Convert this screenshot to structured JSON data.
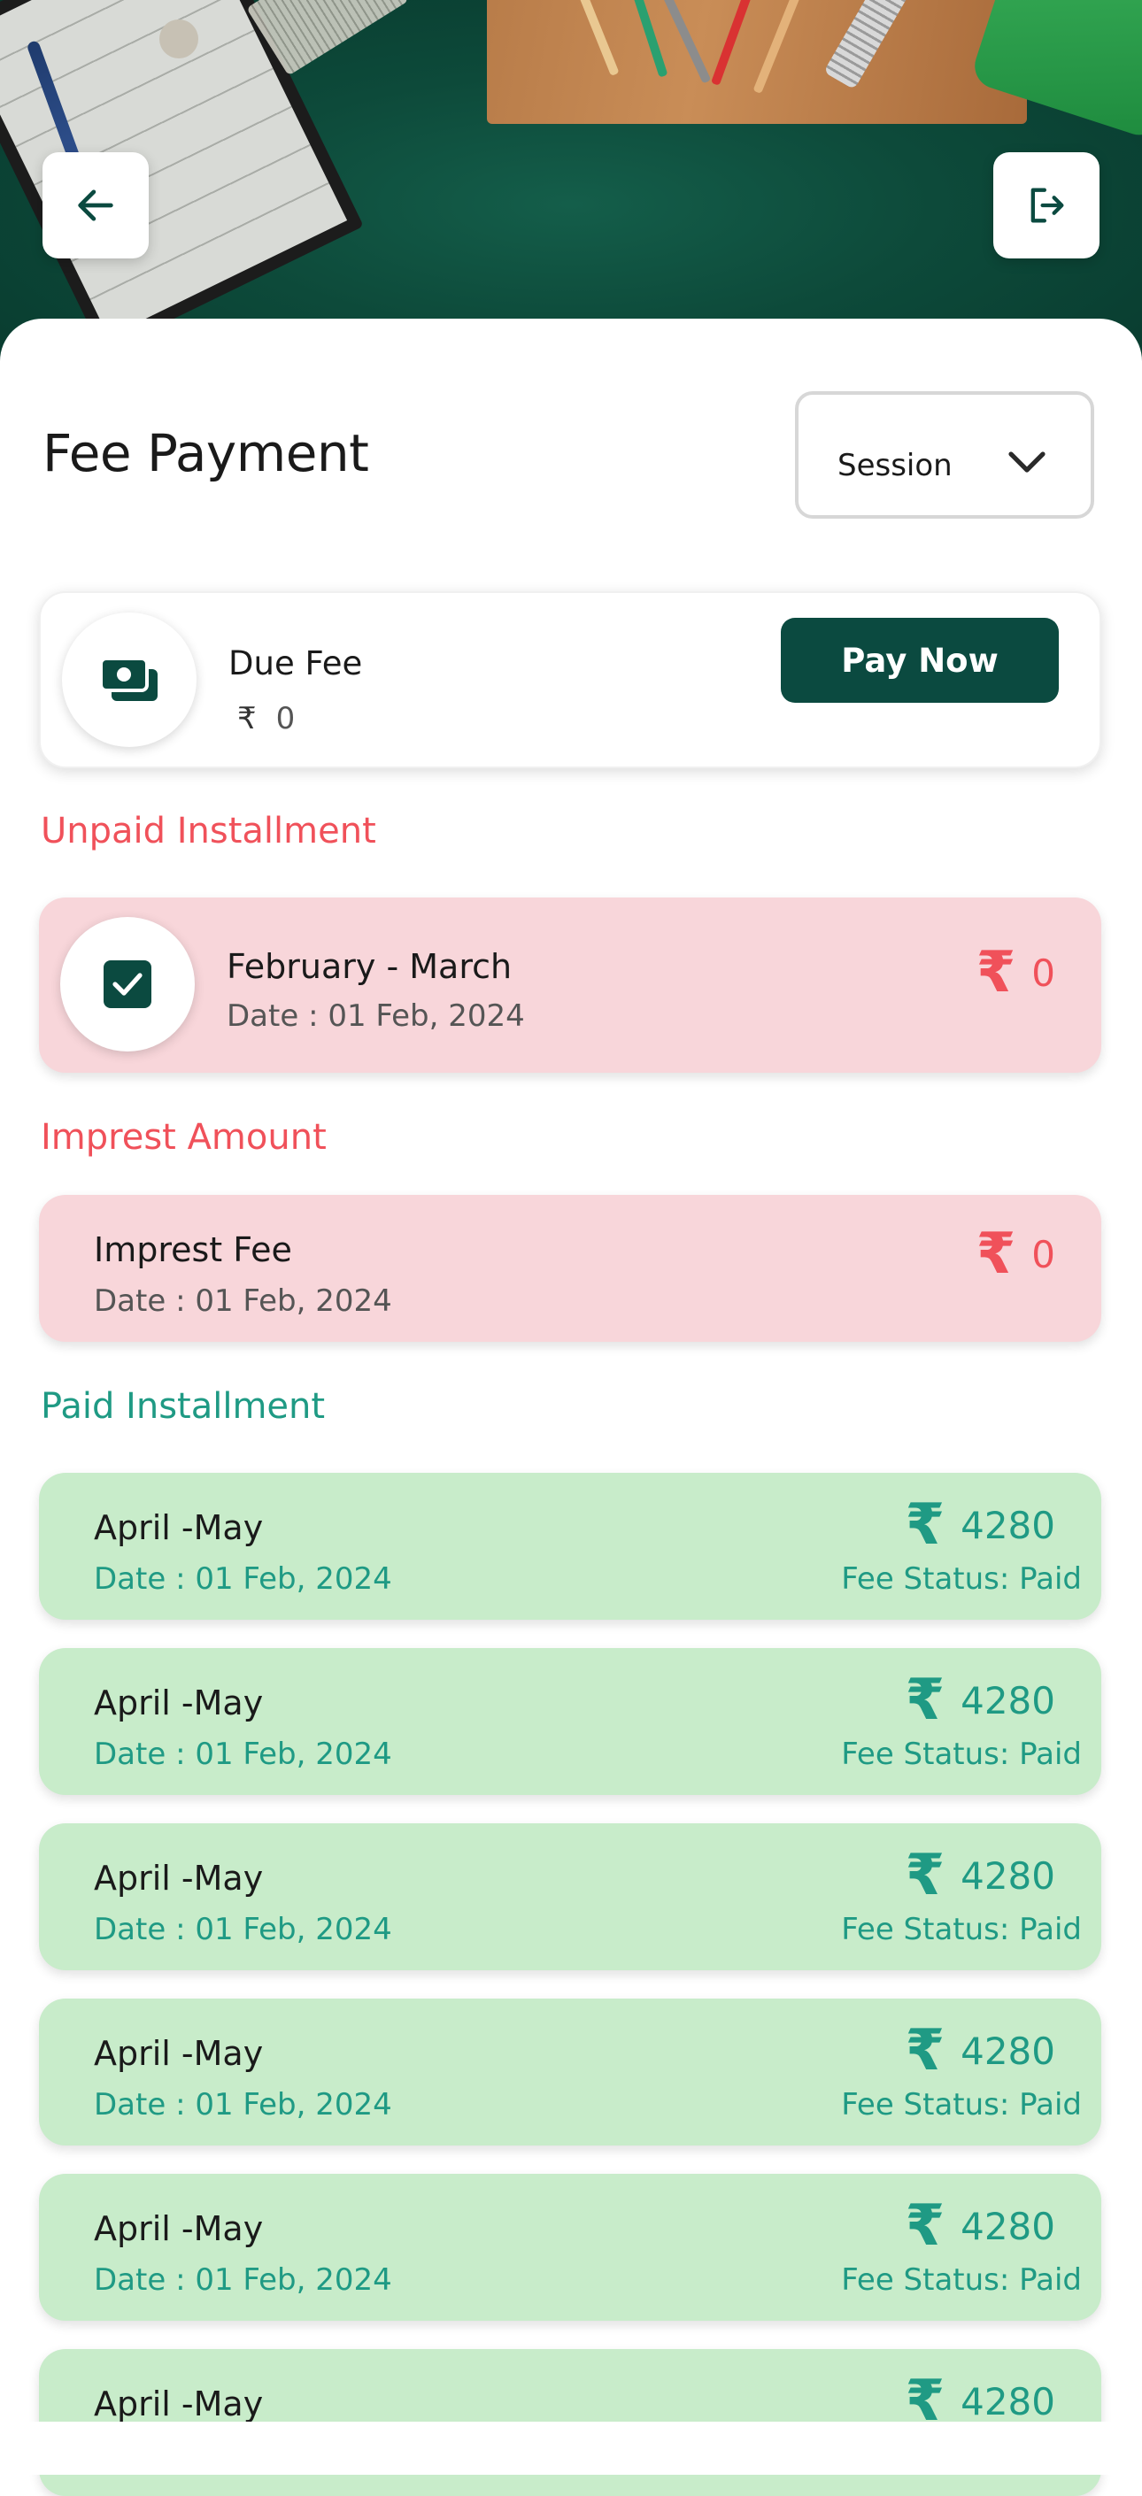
{
  "header": {
    "back_icon": "arrow-left-icon",
    "logout_icon": "logout-icon"
  },
  "page": {
    "title": "Fee Payment"
  },
  "session": {
    "label": "Session",
    "icon": "chevron-down-icon"
  },
  "due_fee": {
    "icon": "money-icon",
    "label": "Due Fee",
    "currency": "₹",
    "amount": "0",
    "pay_button": "Pay Now"
  },
  "sections": {
    "unpaid": "Unpaid Installment",
    "imprest": "Imprest Amount",
    "paid": "Paid Installment"
  },
  "unpaid_installment": {
    "checked": true,
    "title": "February - March",
    "date": "Date : 01 Feb, 2024",
    "currency": "₹",
    "amount": "0"
  },
  "imprest_fee": {
    "title": "Imprest Fee",
    "date": "Date : 01 Feb, 2024",
    "currency": "₹",
    "amount": "0"
  },
  "paid_installments": [
    {
      "title": "April -May",
      "date": "Date : 01 Feb, 2024",
      "currency": "₹",
      "amount": "4280",
      "status": "Fee Status: Paid"
    },
    {
      "title": "April -May",
      "date": "Date : 01 Feb, 2024",
      "currency": "₹",
      "amount": "4280",
      "status": "Fee Status: Paid"
    },
    {
      "title": "April -May",
      "date": "Date : 01 Feb, 2024",
      "currency": "₹",
      "amount": "4280",
      "status": "Fee Status: Paid"
    },
    {
      "title": "April -May",
      "date": "Date : 01 Feb, 2024",
      "currency": "₹",
      "amount": "4280",
      "status": "Fee Status: Paid"
    },
    {
      "title": "April -May",
      "date": "Date : 01 Feb, 2024",
      "currency": "₹",
      "amount": "4280",
      "status": "Fee Status: Paid"
    },
    {
      "title": "April -May",
      "date": "",
      "currency": "₹",
      "amount": "4280",
      "status": ""
    }
  ],
  "colors": {
    "brand_dark": "#0b4a40",
    "unpaid_red": "#f0515a",
    "paid_teal": "#1f9a84",
    "unpaid_bg": "#f8d6da",
    "paid_bg": "#c8ecca"
  }
}
